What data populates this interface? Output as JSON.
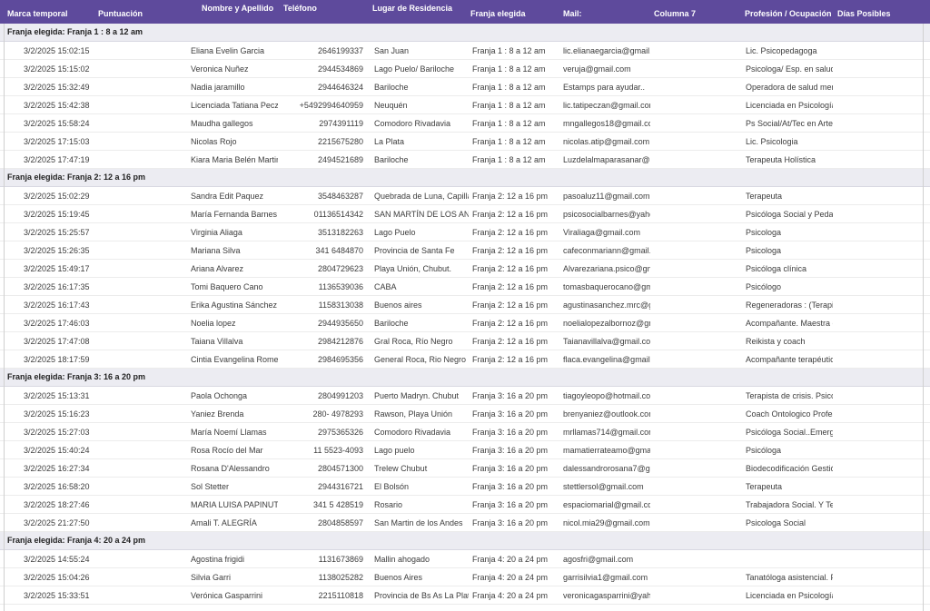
{
  "header": {
    "columns": [
      "Marca temporal",
      "Puntuación",
      "Nombre y Apellido",
      "Teléfono",
      "Lugar de Residencia",
      "Franja elegida",
      "Mail:",
      "Columna 7",
      "Profesión / Ocupación",
      "Días Posibles"
    ]
  },
  "groups": [
    {
      "title": "Franja elegida: Franja 1 : 8 a 12 am",
      "rows": [
        {
          "ts": "3/2/2025 15:02:15",
          "name": "Eliana Evelin Garcia",
          "phone": "2646199337",
          "place": "San Juan",
          "franja": "Franja 1 : 8 a 12 am",
          "mail": "lic.elianaegarcia@gmail.c",
          "prof": "Lic. Psicopedagoga"
        },
        {
          "ts": "3/2/2025 15:15:02",
          "name": "Veronica Nuñez",
          "phone": "2944534869",
          "place": "Lago Puelo/ Bariloche",
          "franja": "Franja 1 : 8 a 12 am",
          "mail": "veruja@gmail.com",
          "prof": "Psicologa/ Esp. en salud"
        },
        {
          "ts": "3/2/2025 15:32:49",
          "name": "Nadia jaramillo",
          "phone": "2944646324",
          "place": "Bariloche",
          "franja": "Franja 1 : 8 a 12 am",
          "mail": "Estamps para ayudar..",
          "prof": "Operadora de salud mem"
        },
        {
          "ts": "3/2/2025 15:42:38",
          "name": "Licenciada Tatiana Pecza",
          "phone": "+5492994640959",
          "place": "Neuquén",
          "franja": "Franja 1 : 8 a 12 am",
          "mail": "lic.tatipeczan@gmail.com",
          "prof": "Licenciada en Psicología"
        },
        {
          "ts": "3/2/2025 15:58:24",
          "name": "Maudha gallegos",
          "phone": "2974391119",
          "place": "Comodoro Rivadavia",
          "franja": "Franja 1 : 8 a 12 am",
          "mail": "mngallegos18@gmail.co",
          "prof": "Ps Social/At/Tec en Arte"
        },
        {
          "ts": "3/2/2025 17:15:03",
          "name": "Nicolas Rojo",
          "phone": "2215675280",
          "place": "La Plata",
          "franja": "Franja 1 : 8 a 12 am",
          "mail": "nicolas.atip@gmail.com",
          "prof": "Lic. Psicologia"
        },
        {
          "ts": "3/2/2025 17:47:19",
          "name": "Kiara Maria Belén Martin",
          "phone": "2494521689",
          "place": "Bariloche",
          "franja": "Franja 1 : 8 a 12 am",
          "mail": "Luzdelalmaparasanar@g",
          "prof": "Terapeuta Holística"
        }
      ]
    },
    {
      "title": "Franja elegida: Franja 2: 12 a 16 pm",
      "rows": [
        {
          "ts": "3/2/2025 15:02:29",
          "name": "Sandra Edit Paquez",
          "phone": "3548463287",
          "place": "Quebrada de Luna, Capilla d",
          "franja": "Franja 2: 12 a 16 pm",
          "mail": "pasoaluz11@gmail.com",
          "prof": "Terapeuta"
        },
        {
          "ts": "3/2/2025 15:19:45",
          "name": "María Fernanda Barnes",
          "phone": "01136514342",
          "place": "SAN MARTÍN DE LOS ANDE",
          "franja": "Franja 2: 12 a 16 pm",
          "mail": "psicosocialbarnes@yahc",
          "prof": "Psicóloga Social y Pedag"
        },
        {
          "ts": "3/2/2025 15:25:57",
          "name": "Virginia Aliaga",
          "phone": "3513182263",
          "place": "Lago Puelo",
          "franja": "Franja 2: 12 a 16 pm",
          "mail": "Viraliaga@gmail.com",
          "prof": "Psicologa"
        },
        {
          "ts": "3/2/2025 15:26:35",
          "name": "Mariana Silva",
          "phone": "341 6484870",
          "place": "Provincia de Santa Fe",
          "franja": "Franja 2: 12 a 16 pm",
          "mail": "cafeconmariann@gmail.c",
          "prof": "Psicologa"
        },
        {
          "ts": "3/2/2025 15:49:17",
          "name": "Ariana Alvarez",
          "phone": "2804729623",
          "place": "Playa Unión, Chubut.",
          "franja": "Franja 2: 12 a 16 pm",
          "mail": "Alvarezariana.psico@gm",
          "prof": "Psicóloga clínica"
        },
        {
          "ts": "3/2/2025 16:17:35",
          "name": "Tomi Baquero Cano",
          "phone": "1136539036",
          "place": "CABA",
          "franja": "Franja 2: 12 a 16 pm",
          "mail": "tomasbaquerocano@gm",
          "prof": "Psicólogo"
        },
        {
          "ts": "3/2/2025 16:17:43",
          "name": "Erika Agustina Sánchez",
          "phone": "1158313038",
          "place": "Buenos aires",
          "franja": "Franja 2: 12 a 16 pm",
          "mail": "agustinasanchez.mrc@g",
          "prof": "Regeneradoras : (Terapia"
        },
        {
          "ts": "3/2/2025 17:46:03",
          "name": "Noelia lopez",
          "phone": "2944935650",
          "place": "Bariloche",
          "franja": "Franja 2: 12 a 16 pm",
          "mail": "noelialopezalbornoz@gn",
          "prof": "Acompañante. Maestra c"
        },
        {
          "ts": "3/2/2025 17:47:08",
          "name": "Taiana Villalva",
          "phone": "2984212876",
          "place": "Gral Roca, Río Negro",
          "franja": "Franja 2: 12 a 16 pm",
          "mail": "Taianavillalva@gmail.cor",
          "prof": "Reikista y coach"
        },
        {
          "ts": "3/2/2025 18:17:59",
          "name": "Cintia Evangelina Romero",
          "phone": "2984695356",
          "place": "General Roca, Rio Negro",
          "franja": "Franja 2: 12 a 16 pm",
          "mail": "flaca.evangelina@gmail.c",
          "prof": "Acompañante terapéutic"
        }
      ]
    },
    {
      "title": "Franja elegida: Franja 3: 16 a 20 pm",
      "rows": [
        {
          "ts": "3/2/2025 15:13:31",
          "name": "Paola Ochonga",
          "phone": "2804991203",
          "place": "Puerto Madryn. Chubut",
          "franja": "Franja 3: 16 a 20 pm",
          "mail": "tiagoyleopo@hotmail.coi",
          "prof": "Terapista de crisis. Psicó"
        },
        {
          "ts": "3/2/2025 15:16:23",
          "name": "Yaniez Brenda",
          "phone": "280- 4978293",
          "place": "Rawson, Playa Unión",
          "franja": "Franja 3: 16 a 20 pm",
          "mail": "brenyaniez@outlook.com",
          "prof": "Coach Ontologico Profes"
        },
        {
          "ts": "3/2/2025 15:27:03",
          "name": "María Noemí Llamas",
          "phone": "2975365326",
          "place": "Comodoro Rivadavia",
          "franja": "Franja 3: 16 a 20 pm",
          "mail": "mrllamas714@gmail.cor",
          "prof": "Psicóloga Social..Emerge"
        },
        {
          "ts": "3/2/2025 15:40:24",
          "name": "Rosa Rocío del Mar",
          "phone": "11 5523-4093",
          "place": "Lago puelo",
          "franja": "Franja 3: 16 a 20 pm",
          "mail": "mamatierrateamo@gmai",
          "prof": "Psicóloga"
        },
        {
          "ts": "3/2/2025 16:27:34",
          "name": "Rosana D'Alessandro",
          "phone": "2804571300",
          "place": "Trelew Chubut",
          "franja": "Franja 3: 16 a 20 pm",
          "mail": "dalessandrorosana7@gn",
          "prof": "Biodecodificación Gestió"
        },
        {
          "ts": "3/2/2025 16:58:20",
          "name": "Sol Stetter",
          "phone": "2944316721",
          "place": "El Bolsón",
          "franja": "Franja 3: 16 a 20 pm",
          "mail": "stettlersol@gmail.com",
          "prof": "Terapeuta"
        },
        {
          "ts": "3/2/2025 18:27:46",
          "name": "MARIA LUISA PAPINUTTI",
          "phone": "341 5 428519",
          "place": "Rosario",
          "franja": "Franja 3: 16 a 20 pm",
          "mail": "espaciomarial@gmail.co",
          "prof": "Trabajadora Social. Y Ter"
        },
        {
          "ts": "3/2/2025 21:27:50",
          "name": "Amali T. ALEGRÍA",
          "phone": "2804858597",
          "place": "San Martin de los Andes",
          "franja": "Franja 3: 16 a 20 pm",
          "mail": "nicol.mia29@gmail.com",
          "prof": "Psicologa Social"
        }
      ]
    },
    {
      "title": "Franja elegida: Franja 4: 20 a 24 pm",
      "rows": [
        {
          "ts": "3/2/2025 14:55:24",
          "name": "Agostina frigidi",
          "phone": "1131673869",
          "place": "Mallin ahogado",
          "franja": "Franja 4: 20 a 24 pm",
          "mail": "agosfri@gmail.com",
          "prof": ""
        },
        {
          "ts": "3/2/2025 15:04:26",
          "name": "Silvia Garri",
          "phone": "1138025282",
          "place": "Buenos Aires",
          "franja": "Franja 4: 20 a 24 pm",
          "mail": "garrisilvia1@gmail.com",
          "prof": "Tanatóloga asistencial. F"
        },
        {
          "ts": "3/2/2025 15:33:51",
          "name": "Verónica Gasparrini",
          "phone": "2215110818",
          "place": "Provincia de Bs As La Plata",
          "franja": "Franja 4: 20 a 24 pm",
          "mail": "veronicagasparrini@yahc",
          "prof": "Licenciada en Psicología"
        }
      ]
    }
  ]
}
